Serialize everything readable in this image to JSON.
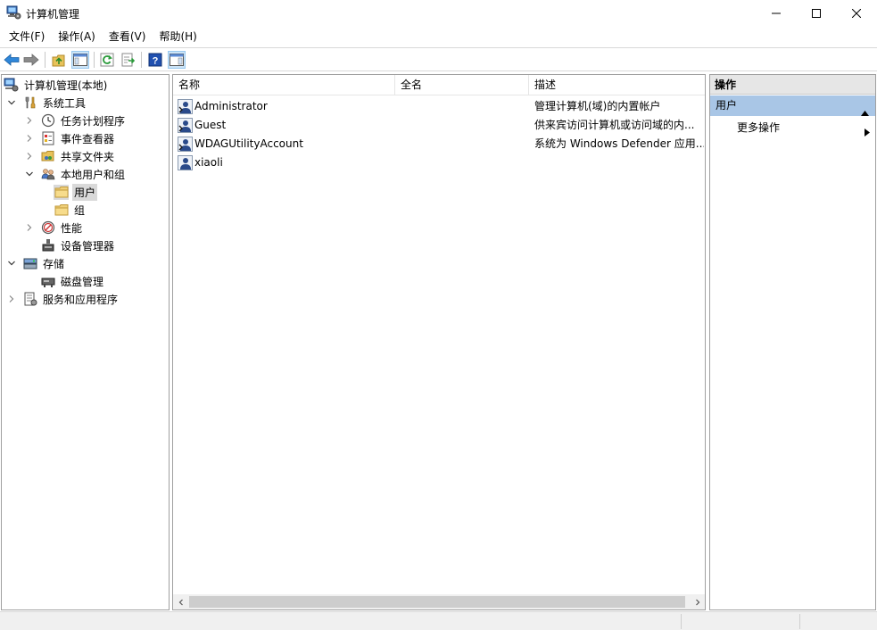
{
  "window": {
    "title": "计算机管理"
  },
  "menu": [
    {
      "label": "文件(F)"
    },
    {
      "label": "操作(A)"
    },
    {
      "label": "查看(V)"
    },
    {
      "label": "帮助(H)"
    }
  ],
  "tree": {
    "root": "计算机管理(本地)",
    "system_tools": "系统工具",
    "task_scheduler": "任务计划程序",
    "event_viewer": "事件查看器",
    "shared_folders": "共享文件夹",
    "local_users_groups": "本地用户和组",
    "users": "用户",
    "groups": "组",
    "performance": "性能",
    "device_manager": "设备管理器",
    "storage": "存储",
    "disk_management": "磁盘管理",
    "services_apps": "服务和应用程序"
  },
  "list": {
    "columns": [
      "名称",
      "全名",
      "描述"
    ],
    "rows": [
      {
        "name": "Administrator",
        "fullname": "",
        "description": "管理计算机(域)的内置帐户"
      },
      {
        "name": "Guest",
        "fullname": "",
        "description": "供来宾访问计算机或访问域的内..."
      },
      {
        "name": "WDAGUtilityAccount",
        "fullname": "",
        "description": "系统为 Windows Defender 应用..."
      },
      {
        "name": "xiaoli",
        "fullname": "",
        "description": ""
      }
    ]
  },
  "actions": {
    "header": "操作",
    "section": "用户",
    "more": "更多操作"
  }
}
